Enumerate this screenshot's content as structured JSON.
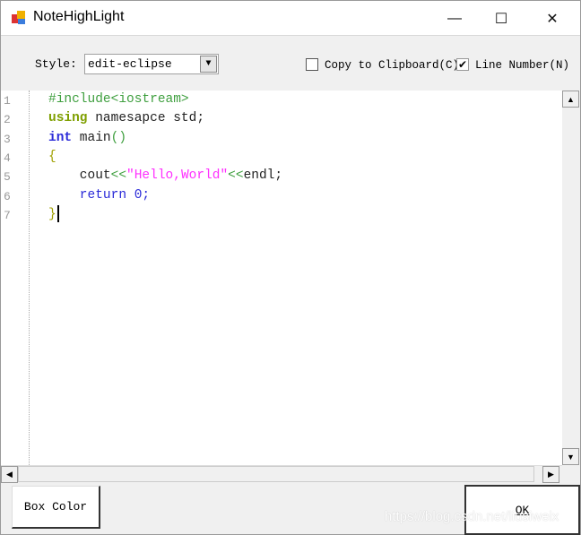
{
  "window": {
    "title": "NoteHighLight",
    "minimize": "—",
    "maximize": "☐",
    "close": "✕"
  },
  "toolbar": {
    "style_label": "Style:",
    "style_value": "edit-eclipse",
    "copy_label": "Copy to Clipboard(C)",
    "copy_checked": false,
    "line_number_label": "Line Number(N)",
    "line_number_checked": true
  },
  "editor": {
    "line_numbers": [
      "1",
      "2",
      "3",
      "4",
      "5",
      "6",
      "7"
    ],
    "lines": [
      [
        {
          "t": "#include<iostream>",
          "c": "#3f9f3f",
          "b": false
        }
      ],
      [
        {
          "t": "using",
          "c": "#7f9f00",
          "b": true
        },
        {
          "t": " namesapce std;",
          "c": "#222",
          "b": false
        }
      ],
      [
        {
          "t": "int",
          "c": "#2a2ad8",
          "b": true
        },
        {
          "t": " main",
          "c": "#222",
          "b": false
        },
        {
          "t": "()",
          "c": "#3f9f3f",
          "b": false
        }
      ],
      [
        {
          "t": "{",
          "c": "#9f9f00",
          "b": false
        }
      ],
      [
        {
          "t": "    cout",
          "c": "#222",
          "b": false
        },
        {
          "t": "<<",
          "c": "#3f9f3f",
          "b": false
        },
        {
          "t": "\"Hello,World\"",
          "c": "#ff30ff",
          "b": false
        },
        {
          "t": "<<",
          "c": "#3f9f3f",
          "b": false
        },
        {
          "t": "endl;",
          "c": "#222",
          "b": false
        }
      ],
      [
        {
          "t": "    return",
          "c": "#2a2ad8",
          "b": false
        },
        {
          "t": " 0;",
          "c": "#2a2ad8",
          "b": false
        }
      ],
      [
        {
          "t": "}",
          "c": "#9f9f00",
          "b": false
        }
      ]
    ]
  },
  "buttons": {
    "box_color": "Box Color",
    "ok": "OK"
  },
  "watermark": "https://blog.csdn.net/liusiweix"
}
